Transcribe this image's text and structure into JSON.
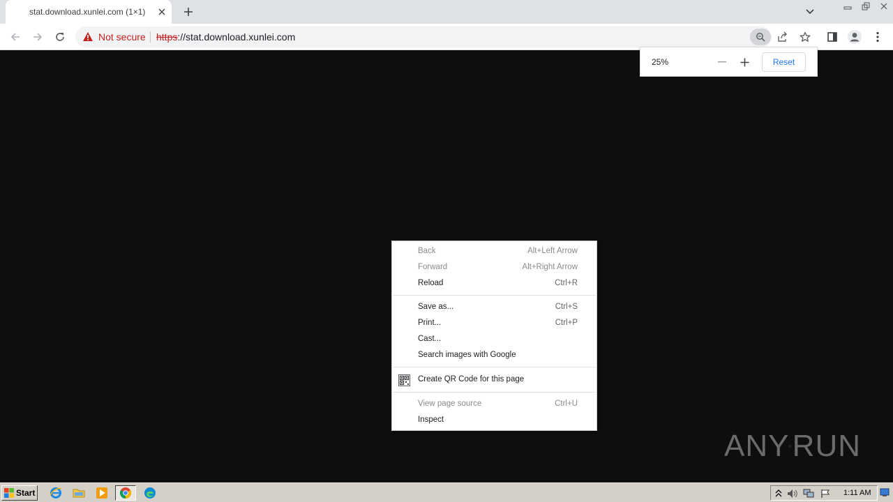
{
  "browser": {
    "tab": {
      "title": "stat.download.xunlei.com (1×1)"
    },
    "omnibox": {
      "security_label": "Not secure",
      "url_scheme": "https",
      "url_rest": "://stat.download.xunlei.com"
    },
    "zoom": {
      "value": "25%",
      "reset_label": "Reset"
    }
  },
  "context_menu": {
    "items": [
      {
        "label": "Back",
        "shortcut": "Alt+Left Arrow",
        "enabled": false
      },
      {
        "label": "Forward",
        "shortcut": "Alt+Right Arrow",
        "enabled": false
      },
      {
        "label": "Reload",
        "shortcut": "Ctrl+R",
        "enabled": true
      },
      {
        "label": "Save as...",
        "shortcut": "Ctrl+S",
        "enabled": true
      },
      {
        "label": "Print...",
        "shortcut": "Ctrl+P",
        "enabled": true
      },
      {
        "label": "Cast...",
        "shortcut": "",
        "enabled": true
      },
      {
        "label": "Search images with Google",
        "shortcut": "",
        "enabled": true
      },
      {
        "label": "Create QR Code for this page",
        "shortcut": "",
        "enabled": true,
        "icon": "qr-code-icon"
      },
      {
        "label": "View page source",
        "shortcut": "Ctrl+U",
        "enabled": false
      },
      {
        "label": "Inspect",
        "shortcut": "",
        "enabled": true
      }
    ]
  },
  "watermark": {
    "text_left": "ANY",
    "text_right": "RUN"
  },
  "taskbar": {
    "start_label": "Start",
    "clock": "1:11 AM",
    "icons": [
      "ie-icon",
      "explorer-folder-icon",
      "media-player-icon",
      "chrome-icon",
      "edge-icon"
    ]
  },
  "colors": {
    "page_bg": "#0e0e0e",
    "warning_red": "#c5221f",
    "link_blue": "#1a73e8",
    "taskbar_gray": "#d4d0c8"
  }
}
